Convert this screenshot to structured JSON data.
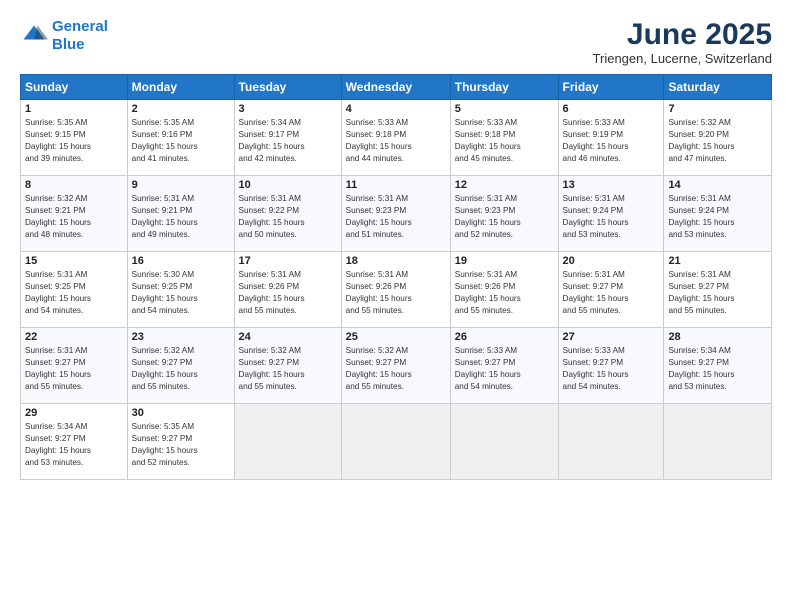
{
  "logo": {
    "line1": "General",
    "line2": "Blue"
  },
  "title": "June 2025",
  "location": "Triengen, Lucerne, Switzerland",
  "headers": [
    "Sunday",
    "Monday",
    "Tuesday",
    "Wednesday",
    "Thursday",
    "Friday",
    "Saturday"
  ],
  "weeks": [
    [
      {
        "day": "1",
        "detail": "Sunrise: 5:35 AM\nSunset: 9:15 PM\nDaylight: 15 hours\nand 39 minutes."
      },
      {
        "day": "2",
        "detail": "Sunrise: 5:35 AM\nSunset: 9:16 PM\nDaylight: 15 hours\nand 41 minutes."
      },
      {
        "day": "3",
        "detail": "Sunrise: 5:34 AM\nSunset: 9:17 PM\nDaylight: 15 hours\nand 42 minutes."
      },
      {
        "day": "4",
        "detail": "Sunrise: 5:33 AM\nSunset: 9:18 PM\nDaylight: 15 hours\nand 44 minutes."
      },
      {
        "day": "5",
        "detail": "Sunrise: 5:33 AM\nSunset: 9:18 PM\nDaylight: 15 hours\nand 45 minutes."
      },
      {
        "day": "6",
        "detail": "Sunrise: 5:33 AM\nSunset: 9:19 PM\nDaylight: 15 hours\nand 46 minutes."
      },
      {
        "day": "7",
        "detail": "Sunrise: 5:32 AM\nSunset: 9:20 PM\nDaylight: 15 hours\nand 47 minutes."
      }
    ],
    [
      {
        "day": "8",
        "detail": "Sunrise: 5:32 AM\nSunset: 9:21 PM\nDaylight: 15 hours\nand 48 minutes."
      },
      {
        "day": "9",
        "detail": "Sunrise: 5:31 AM\nSunset: 9:21 PM\nDaylight: 15 hours\nand 49 minutes."
      },
      {
        "day": "10",
        "detail": "Sunrise: 5:31 AM\nSunset: 9:22 PM\nDaylight: 15 hours\nand 50 minutes."
      },
      {
        "day": "11",
        "detail": "Sunrise: 5:31 AM\nSunset: 9:23 PM\nDaylight: 15 hours\nand 51 minutes."
      },
      {
        "day": "12",
        "detail": "Sunrise: 5:31 AM\nSunset: 9:23 PM\nDaylight: 15 hours\nand 52 minutes."
      },
      {
        "day": "13",
        "detail": "Sunrise: 5:31 AM\nSunset: 9:24 PM\nDaylight: 15 hours\nand 53 minutes."
      },
      {
        "day": "14",
        "detail": "Sunrise: 5:31 AM\nSunset: 9:24 PM\nDaylight: 15 hours\nand 53 minutes."
      }
    ],
    [
      {
        "day": "15",
        "detail": "Sunrise: 5:31 AM\nSunset: 9:25 PM\nDaylight: 15 hours\nand 54 minutes."
      },
      {
        "day": "16",
        "detail": "Sunrise: 5:30 AM\nSunset: 9:25 PM\nDaylight: 15 hours\nand 54 minutes."
      },
      {
        "day": "17",
        "detail": "Sunrise: 5:31 AM\nSunset: 9:26 PM\nDaylight: 15 hours\nand 55 minutes."
      },
      {
        "day": "18",
        "detail": "Sunrise: 5:31 AM\nSunset: 9:26 PM\nDaylight: 15 hours\nand 55 minutes."
      },
      {
        "day": "19",
        "detail": "Sunrise: 5:31 AM\nSunset: 9:26 PM\nDaylight: 15 hours\nand 55 minutes."
      },
      {
        "day": "20",
        "detail": "Sunrise: 5:31 AM\nSunset: 9:27 PM\nDaylight: 15 hours\nand 55 minutes."
      },
      {
        "day": "21",
        "detail": "Sunrise: 5:31 AM\nSunset: 9:27 PM\nDaylight: 15 hours\nand 55 minutes."
      }
    ],
    [
      {
        "day": "22",
        "detail": "Sunrise: 5:31 AM\nSunset: 9:27 PM\nDaylight: 15 hours\nand 55 minutes."
      },
      {
        "day": "23",
        "detail": "Sunrise: 5:32 AM\nSunset: 9:27 PM\nDaylight: 15 hours\nand 55 minutes."
      },
      {
        "day": "24",
        "detail": "Sunrise: 5:32 AM\nSunset: 9:27 PM\nDaylight: 15 hours\nand 55 minutes."
      },
      {
        "day": "25",
        "detail": "Sunrise: 5:32 AM\nSunset: 9:27 PM\nDaylight: 15 hours\nand 55 minutes."
      },
      {
        "day": "26",
        "detail": "Sunrise: 5:33 AM\nSunset: 9:27 PM\nDaylight: 15 hours\nand 54 minutes."
      },
      {
        "day": "27",
        "detail": "Sunrise: 5:33 AM\nSunset: 9:27 PM\nDaylight: 15 hours\nand 54 minutes."
      },
      {
        "day": "28",
        "detail": "Sunrise: 5:34 AM\nSunset: 9:27 PM\nDaylight: 15 hours\nand 53 minutes."
      }
    ],
    [
      {
        "day": "29",
        "detail": "Sunrise: 5:34 AM\nSunset: 9:27 PM\nDaylight: 15 hours\nand 53 minutes."
      },
      {
        "day": "30",
        "detail": "Sunrise: 5:35 AM\nSunset: 9:27 PM\nDaylight: 15 hours\nand 52 minutes."
      },
      {
        "day": "",
        "detail": "",
        "empty": true
      },
      {
        "day": "",
        "detail": "",
        "empty": true
      },
      {
        "day": "",
        "detail": "",
        "empty": true
      },
      {
        "day": "",
        "detail": "",
        "empty": true
      },
      {
        "day": "",
        "detail": "",
        "empty": true
      }
    ]
  ]
}
